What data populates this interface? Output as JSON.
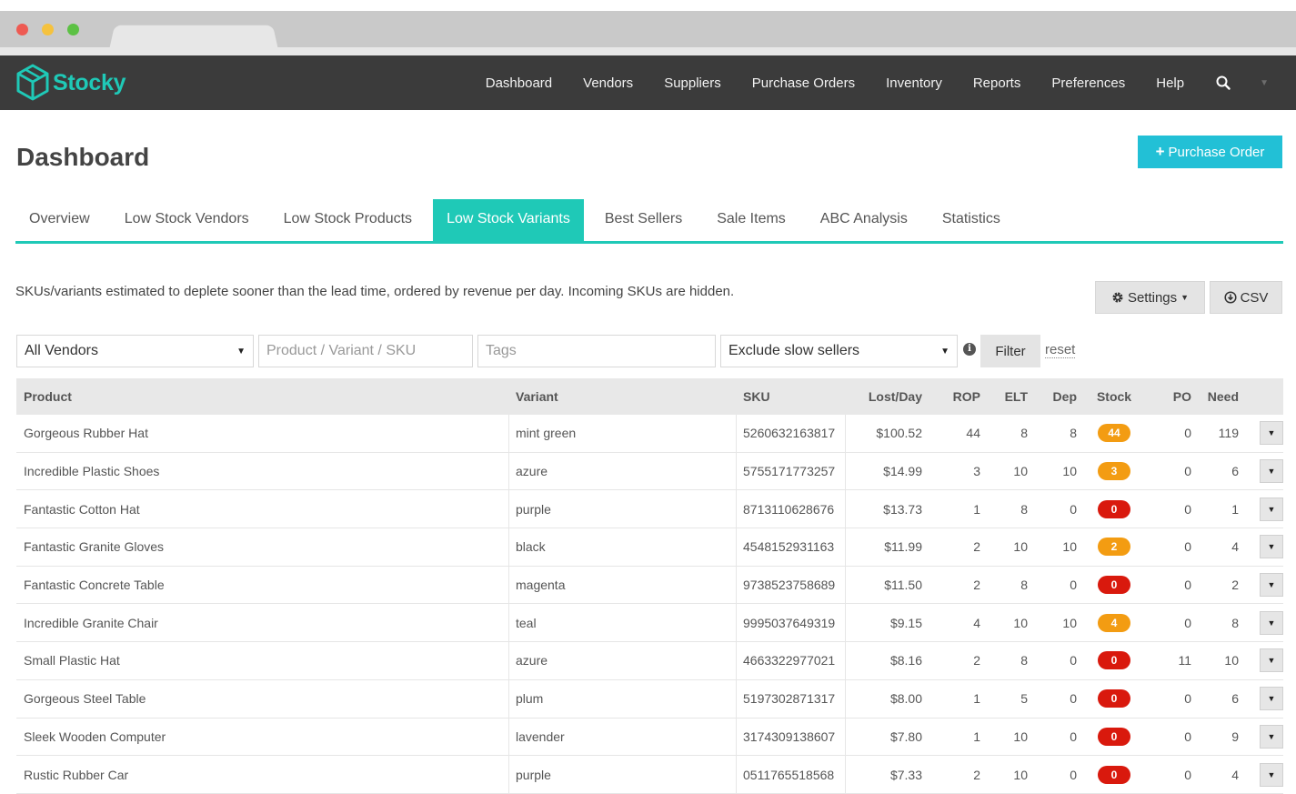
{
  "app": {
    "brand": "Stocky",
    "brand_color": "#1fc9b7"
  },
  "nav": {
    "items": [
      "Dashboard",
      "Vendors",
      "Suppliers",
      "Purchase Orders",
      "Inventory",
      "Reports",
      "Preferences",
      "Help"
    ],
    "search_icon": "search-icon",
    "caret_icon": "chevron-down-icon"
  },
  "page": {
    "title": "Dashboard",
    "purchase_order_button": "Purchase Order",
    "purchase_order_icon": "plus-icon",
    "accent_color": "#22c0d6"
  },
  "tabs": {
    "items": [
      "Overview",
      "Low Stock Vendors",
      "Low Stock Products",
      "Low Stock Variants",
      "Best Sellers",
      "Sale Items",
      "ABC Analysis",
      "Statistics"
    ],
    "active": "Low Stock Variants"
  },
  "description": "SKUs/variants estimated to deplete sooner than the lead time, ordered by revenue per day. Incoming SKUs are hidden.",
  "toolbar": {
    "settings_label": "Settings",
    "settings_icon": "gear-icon",
    "csv_label": "CSV",
    "csv_icon": "download-icon"
  },
  "filters": {
    "vendor_select": "All Vendors",
    "product_placeholder": "Product / Variant / SKU",
    "tags_placeholder": "Tags",
    "sellers_select": "Exclude slow sellers",
    "info_icon": "info-icon",
    "filter_button": "Filter",
    "reset_link": "reset"
  },
  "table": {
    "columns": [
      "Product",
      "Variant",
      "SKU",
      "Lost/Day",
      "ROP",
      "ELT",
      "Dep",
      "Stock",
      "PO",
      "Need"
    ],
    "stock_colors": {
      "low": "#f39c12",
      "zero": "#d9190d"
    },
    "rows": [
      {
        "product": "Gorgeous Rubber Hat",
        "variant": "mint green",
        "sku": "5260632163817",
        "lost_day": "$100.52",
        "rop": "44",
        "elt": "8",
        "dep": "8",
        "stock": "44",
        "stock_status": "low",
        "po": "0",
        "need": "119"
      },
      {
        "product": "Incredible Plastic Shoes",
        "variant": "azure",
        "sku": "5755171773257",
        "lost_day": "$14.99",
        "rop": "3",
        "elt": "10",
        "dep": "10",
        "stock": "3",
        "stock_status": "low",
        "po": "0",
        "need": "6"
      },
      {
        "product": "Fantastic Cotton Hat",
        "variant": "purple",
        "sku": "8713110628676",
        "lost_day": "$13.73",
        "rop": "1",
        "elt": "8",
        "dep": "0",
        "stock": "0",
        "stock_status": "zero",
        "po": "0",
        "need": "1"
      },
      {
        "product": "Fantastic Granite Gloves",
        "variant": "black",
        "sku": "4548152931163",
        "lost_day": "$11.99",
        "rop": "2",
        "elt": "10",
        "dep": "10",
        "stock": "2",
        "stock_status": "low",
        "po": "0",
        "need": "4"
      },
      {
        "product": "Fantastic Concrete Table",
        "variant": "magenta",
        "sku": "9738523758689",
        "lost_day": "$11.50",
        "rop": "2",
        "elt": "8",
        "dep": "0",
        "stock": "0",
        "stock_status": "zero",
        "po": "0",
        "need": "2"
      },
      {
        "product": "Incredible Granite Chair",
        "variant": "teal",
        "sku": "9995037649319",
        "lost_day": "$9.15",
        "rop": "4",
        "elt": "10",
        "dep": "10",
        "stock": "4",
        "stock_status": "low",
        "po": "0",
        "need": "8"
      },
      {
        "product": "Small Plastic Hat",
        "variant": "azure",
        "sku": "4663322977021",
        "lost_day": "$8.16",
        "rop": "2",
        "elt": "8",
        "dep": "0",
        "stock": "0",
        "stock_status": "zero",
        "po": "11",
        "need": "10"
      },
      {
        "product": "Gorgeous Steel Table",
        "variant": "plum",
        "sku": "5197302871317",
        "lost_day": "$8.00",
        "rop": "1",
        "elt": "5",
        "dep": "0",
        "stock": "0",
        "stock_status": "zero",
        "po": "0",
        "need": "6"
      },
      {
        "product": "Sleek Wooden Computer",
        "variant": "lavender",
        "sku": "3174309138607",
        "lost_day": "$7.80",
        "rop": "1",
        "elt": "10",
        "dep": "0",
        "stock": "0",
        "stock_status": "zero",
        "po": "0",
        "need": "9"
      },
      {
        "product": "Rustic Rubber Car",
        "variant": "purple",
        "sku": "0511765518568",
        "lost_day": "$7.33",
        "rop": "2",
        "elt": "10",
        "dep": "0",
        "stock": "0",
        "stock_status": "zero",
        "po": "0",
        "need": "4"
      }
    ]
  }
}
